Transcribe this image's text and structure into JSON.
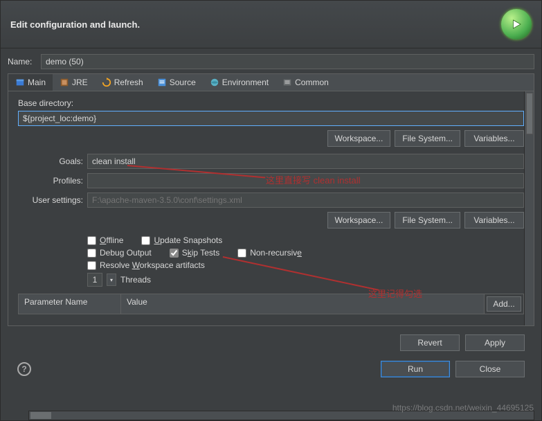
{
  "header": {
    "title": "Edit configuration and launch."
  },
  "name": {
    "label": "Name:",
    "value": "demo (50)"
  },
  "tabs": [
    {
      "label": "Main",
      "icon": "main-tab-icon",
      "active": true
    },
    {
      "label": "JRE",
      "icon": "jre-tab-icon"
    },
    {
      "label": "Refresh",
      "icon": "refresh-tab-icon"
    },
    {
      "label": "Source",
      "icon": "source-tab-icon"
    },
    {
      "label": "Environment",
      "icon": "env-tab-icon"
    },
    {
      "label": "Common",
      "icon": "common-tab-icon"
    }
  ],
  "main": {
    "base_dir_label": "Base directory:",
    "base_dir_value": "${project_loc:demo}",
    "workspace": "Workspace...",
    "file_system": "File System...",
    "variables": "Variables...",
    "goals_label": "Goals:",
    "goals_value": "clean install",
    "profiles_label": "Profiles:",
    "profiles_value": "",
    "user_settings_label": "User settings:",
    "user_settings_placeholder": "F:\\apache-maven-3.5.0\\conf\\settings.xml",
    "checks": {
      "offline": "Offline",
      "update_snapshots": "Update Snapshots",
      "debug_output": "Debug Output",
      "skip_tests": "Skip Tests",
      "non_recursive": "Non-recursive",
      "resolve_ws": "Resolve Workspace artifacts"
    },
    "threads": {
      "value": "1",
      "label": "Threads"
    },
    "table": {
      "col_name": "Parameter Name",
      "col_value": "Value",
      "add": "Add..."
    }
  },
  "annotations": {
    "goals_note": "这里直接写 clean install",
    "skip_note": "这里记得勾选"
  },
  "buttons": {
    "revert": "Revert",
    "apply": "Apply",
    "run": "Run",
    "close": "Close"
  },
  "watermark": "https://blog.csdn.net/weixin_44695125"
}
